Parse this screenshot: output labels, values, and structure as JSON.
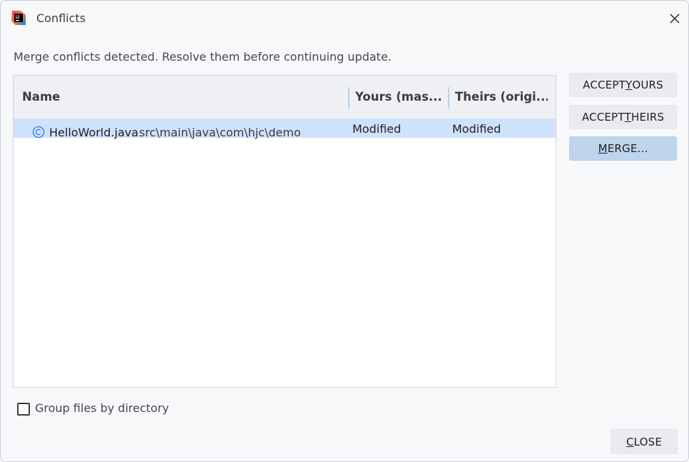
{
  "window": {
    "title": "Conflicts",
    "app_icon": "intellij-idea-icon",
    "close_icon": "close-icon"
  },
  "message": "Merge conflicts detected. Resolve them before continuing update.",
  "table": {
    "columns": [
      "Name",
      "Yours (mas...",
      "Theirs (origi..."
    ],
    "rows": [
      {
        "icon": "java-class-icon",
        "file": "HelloWorld.java",
        "path": "src\\main\\java\\com\\hjc\\demo",
        "yours": "Modified",
        "theirs": "Modified",
        "selected": true
      }
    ]
  },
  "buttons": {
    "accept_yours": {
      "before": "ACCEPT ",
      "mnemonic": "Y",
      "after": "OURS"
    },
    "accept_theirs": {
      "before": "ACCEPT ",
      "mnemonic": "T",
      "after": "HEIRS"
    },
    "merge": {
      "before": "",
      "mnemonic": "M",
      "after": "ERGE..."
    },
    "close": {
      "before": "",
      "mnemonic": "C",
      "after": "LOSE"
    }
  },
  "options": {
    "group_by_directory": {
      "label": "Group files by directory",
      "checked": false
    }
  },
  "colors": {
    "selection": "#cfe2fb",
    "merge_button": "#bfd5ee",
    "header_separator": "#b5d3f3"
  }
}
